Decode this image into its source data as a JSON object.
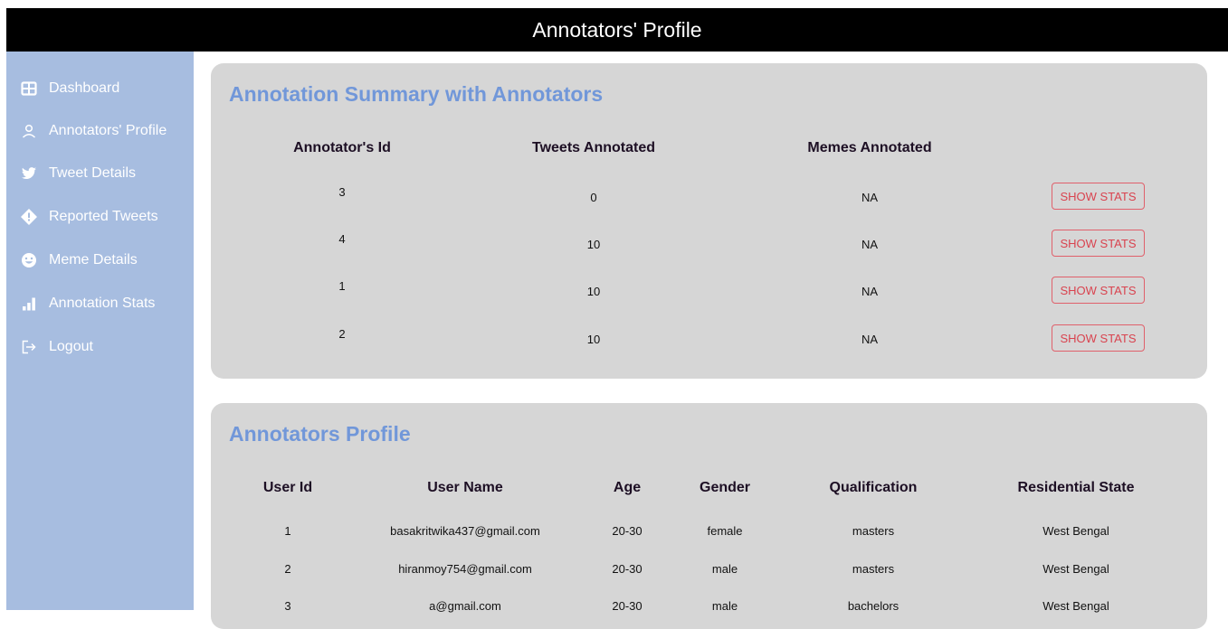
{
  "header": {
    "title": "Annotators' Profile"
  },
  "colors": {
    "header_bg": "#000000",
    "sidebar_bg": "#a7bde0",
    "card_bg": "#d6d6d6",
    "title_blue": "#7197d9",
    "button_red": "#d9434f"
  },
  "sidebar": {
    "items": [
      {
        "label": "Dashboard",
        "icon": "dashboard-icon"
      },
      {
        "label": "Annotators' Profile",
        "icon": "person-icon"
      },
      {
        "label": "Tweet Details",
        "icon": "twitter-bird-icon"
      },
      {
        "label": "Reported Tweets",
        "icon": "report-diamond-icon"
      },
      {
        "label": "Meme Details",
        "icon": "smiley-icon"
      },
      {
        "label": "Annotation Stats",
        "icon": "bar-chart-icon"
      },
      {
        "label": "Logout",
        "icon": "logout-icon"
      }
    ]
  },
  "summary": {
    "title": "Annotation Summary with Annotators",
    "headers": {
      "id": "Annotator's Id",
      "tweets": "Tweets Annotated",
      "memes": "Memes Annotated"
    },
    "button_label": "SHOW STATS",
    "rows": [
      {
        "id": "3",
        "tweets": "0",
        "memes": "NA"
      },
      {
        "id": "4",
        "tweets": "10",
        "memes": "NA"
      },
      {
        "id": "1",
        "tweets": "10",
        "memes": "NA"
      },
      {
        "id": "2",
        "tweets": "10",
        "memes": "NA"
      }
    ]
  },
  "profile": {
    "title": "Annotators Profile",
    "headers": {
      "user_id": "User Id",
      "user_name": "User Name",
      "age": "Age",
      "gender": "Gender",
      "qualification": "Qualification",
      "state": "Residential State"
    },
    "rows": [
      {
        "user_id": "1",
        "user_name": "basakritwika437@gmail.com",
        "age": "20-30",
        "gender": "female",
        "qualification": "masters",
        "state": "West Bengal"
      },
      {
        "user_id": "2",
        "user_name": "hiranmoy754@gmail.com",
        "age": "20-30",
        "gender": "male",
        "qualification": "masters",
        "state": "West Bengal"
      },
      {
        "user_id": "3",
        "user_name": "a@gmail.com",
        "age": "20-30",
        "gender": "male",
        "qualification": "bachelors",
        "state": "West Bengal"
      }
    ]
  }
}
